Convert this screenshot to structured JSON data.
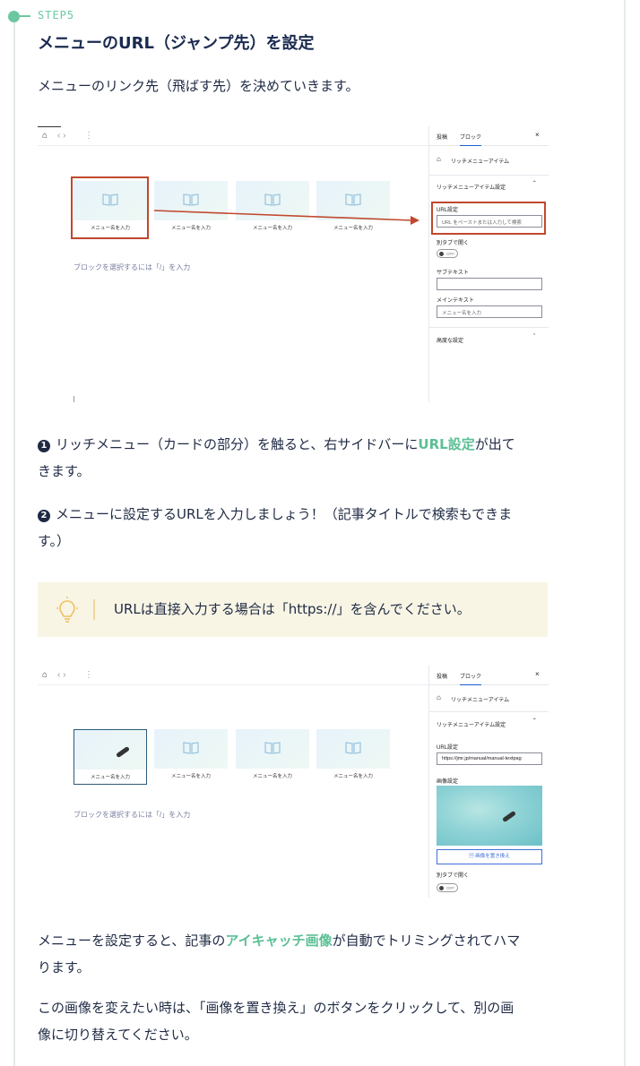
{
  "step": {
    "label": "STEP5"
  },
  "title": "メニューのURL（ジャンプ先）を設定",
  "intro": "メニューのリンク先（飛ばす先）を決めていきます。",
  "editor1": {
    "tabs": [
      "投稿",
      "ブロック"
    ],
    "block_name": "リッチメニューアイテム",
    "panel_title": "リッチメニューアイテム設定",
    "url_label": "URL設定",
    "url_placeholder": "URL をペーストまたは入力して検索",
    "newtab_label": "別タブで開く",
    "toggle_text": "OFF",
    "subtext_label": "サブテキスト",
    "maintext_label": "メインテキスト",
    "maintext_placeholder": "メニュー名を入力",
    "advanced_label": "高度な設定",
    "card_label": "メニュー名を入力",
    "hint": "ブロックを選択するには「/」を入力",
    "close": "×"
  },
  "note1": {
    "num": "1",
    "before": "リッチメニュー（カードの部分）を触ると、右サイドバーに",
    "highlight": "URL設定",
    "after_line1": "が出て",
    "line2": "きます。"
  },
  "note2": {
    "num": "2",
    "line1": "メニューに設定するURLを入力しましょう！（記事タイトルで検索もできま",
    "line2": "す。）"
  },
  "tip": "URLは直接入力する場合は「https://」を含んでください。",
  "editor2": {
    "tabs": [
      "投稿",
      "ブロック"
    ],
    "block_name": "リッチメニューアイテム",
    "panel_title": "リッチメニューアイテム設定",
    "url_label": "URL設定",
    "url_value": "https://jmr.jp/manual/manual-textpag",
    "image_label": "画像設定",
    "replace_button": "画像を置き換え",
    "newtab_label": "別タブで開く",
    "toggle_text": "OFF",
    "card_label": "メニュー名を入力",
    "hint": "ブロックを選択するには「/」を入力",
    "close": "×"
  },
  "para3": {
    "before": "メニューを設定すると、記事の",
    "highlight": "アイキャッチ画像",
    "after": "が自動でトリミングされてハマ",
    "line2": "ります。"
  },
  "para4": {
    "line1": "この画像を変えたい時は、「画像を置き換え」のボタンをクリックして、別の画",
    "line2": "像に切り替えてください。"
  },
  "colors": {
    "accent": "#6cc7a1",
    "highlight_red": "#c0482d",
    "tip_bg": "#f8f5e5"
  }
}
